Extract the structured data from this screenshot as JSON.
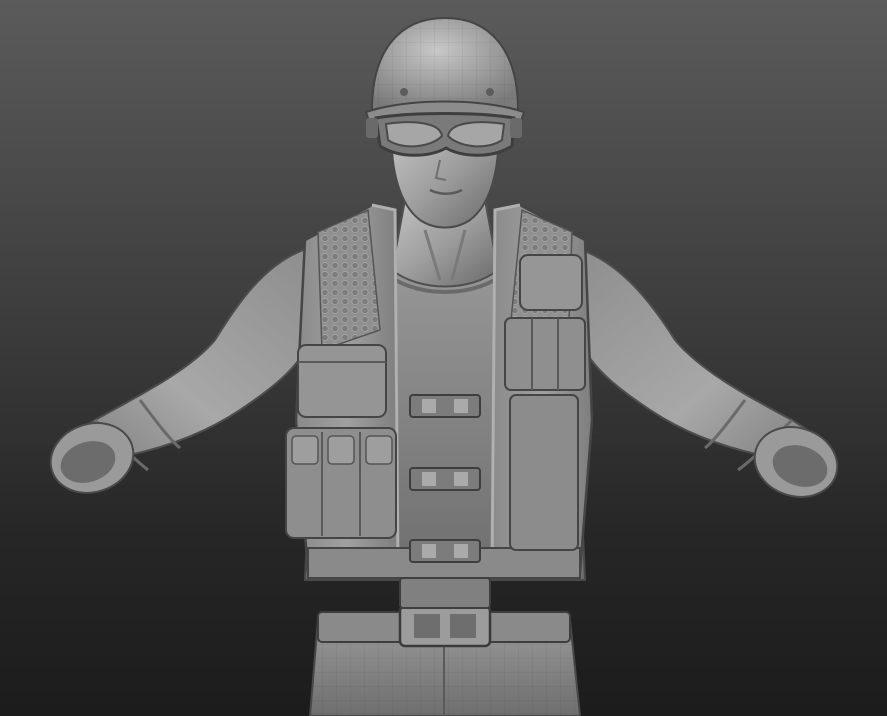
{
  "viewport": {
    "background_top": "#5b5b5b",
    "background_bottom": "#1c1c1c"
  },
  "model": {
    "material_light": "#b4b4b4",
    "material_mid": "#8f8f8f",
    "material_dark": "#5a5a5a",
    "outline": "#3a3a3a",
    "parts": [
      "helmet",
      "goggles",
      "head",
      "neck",
      "torso-shirt",
      "left-arm",
      "right-arm",
      "tactical-vest",
      "vest-pouches",
      "vest-buckles",
      "belt",
      "pants"
    ]
  }
}
